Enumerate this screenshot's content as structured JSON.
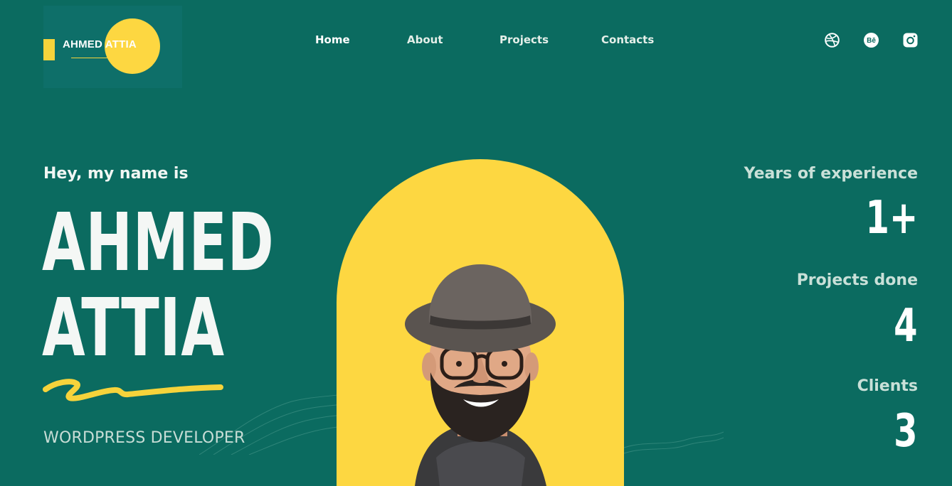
{
  "logo": {
    "text": "AHMED ATTIA"
  },
  "nav": {
    "items": [
      {
        "label": "Home"
      },
      {
        "label": "About"
      },
      {
        "label": "Projects"
      },
      {
        "label": "Contacts"
      }
    ]
  },
  "social": {
    "icons": [
      "dribbble-icon",
      "behance-icon",
      "instagram-icon"
    ]
  },
  "hero": {
    "greeting": "Hey, my name is",
    "first_name": "AHMED",
    "last_name": "ATTIA",
    "role": "WORDPRESS DEVELOPER"
  },
  "stats": [
    {
      "label": "Years of experience",
      "value": "1+"
    },
    {
      "label": "Projects done",
      "value": "4"
    },
    {
      "label": "Clients",
      "value": "3"
    }
  ],
  "colors": {
    "background": "#0b6b60",
    "accent": "#fdd741",
    "text": "#f4f7f5"
  }
}
